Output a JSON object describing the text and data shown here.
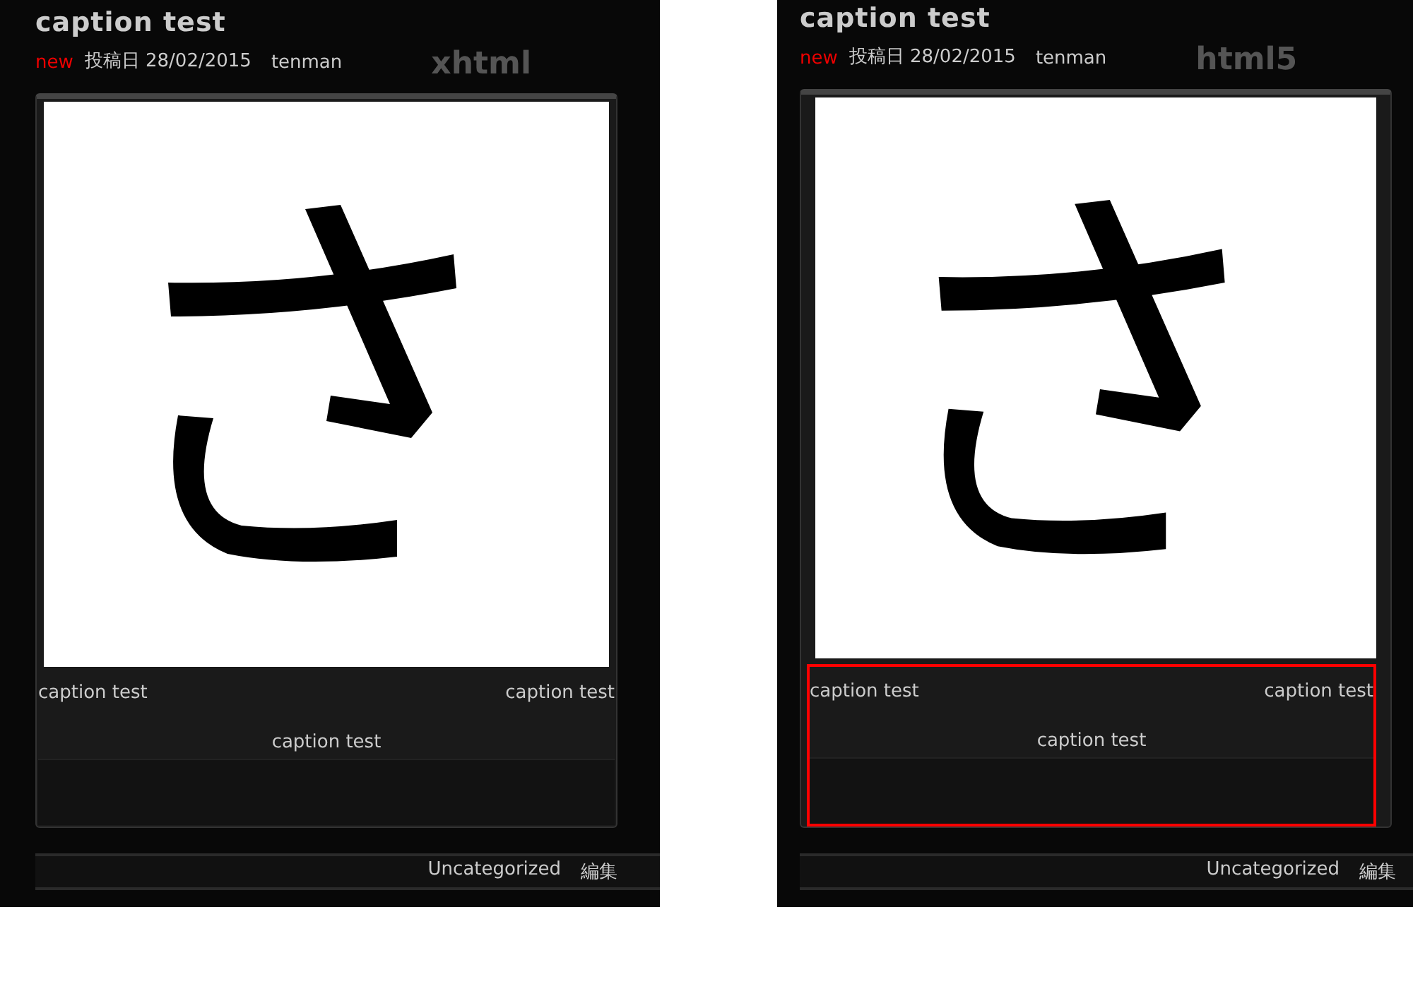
{
  "panels": [
    {
      "title": "caption test",
      "new_badge": "new",
      "date": "投稿日 28/02/2015",
      "author": "tenman",
      "doctype": "xhtml",
      "highlighted": false,
      "captions": {
        "left": "caption test",
        "right": "caption test",
        "center": "caption test"
      },
      "category": "Uncategorized",
      "edit": "編集"
    },
    {
      "title": "caption test",
      "new_badge": "new",
      "date": "投稿日 28/02/2015",
      "author": "tenman",
      "doctype": "html5",
      "highlighted": true,
      "captions": {
        "left": "caption test",
        "right": "caption test",
        "center": "caption test"
      },
      "category": "Uncategorized",
      "edit": "編集"
    }
  ]
}
